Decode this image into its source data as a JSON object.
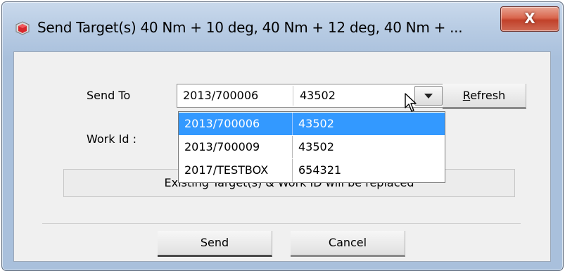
{
  "window": {
    "title": "Send Target(s) 40 Nm + 10 deg, 40 Nm + 12 deg, 40 Nm + ...",
    "close_label": "X"
  },
  "form": {
    "send_to_label": "Send To",
    "work_id_label": "Work Id :",
    "selected": {
      "col1": "2013/700006",
      "col2": "43502"
    },
    "refresh_label_prefix": "",
    "refresh_label_underlined": "R",
    "refresh_label_rest": "efresh",
    "options": [
      {
        "col1": "2013/700006",
        "col2": "43502",
        "selected": true
      },
      {
        "col1": "2013/700009",
        "col2": "43502",
        "selected": false
      },
      {
        "col1": "2017/TESTBOX",
        "col2": "654321",
        "selected": false
      }
    ],
    "notice": "Existing Target(s) & Work ID will be replaced"
  },
  "buttons": {
    "send_label": "Send",
    "cancel_label": "Cancel"
  },
  "colors": {
    "selection": "#3399ff",
    "close_button": "#c8452f",
    "title_gradient": "#b7cbe3"
  },
  "icons": {
    "app": "red-cube-icon",
    "close": "close-icon",
    "dropdown": "chevron-down-icon",
    "cursor": "mouse-cursor-icon"
  }
}
